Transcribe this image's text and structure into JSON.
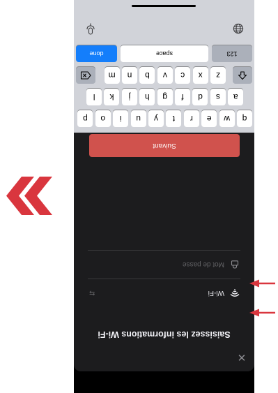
{
  "dialog": {
    "close_icon": "close-icon",
    "title": "Saisissez les informations Wi‑Fi",
    "network_field": {
      "value": "Wi‑Fi",
      "icon": "wifi-icon",
      "chevron": "⇆"
    },
    "password_field": {
      "placeholder": "Mot de passe",
      "icon": "lock-icon"
    },
    "next_label": "Suivant",
    "next_color": "#d0524d"
  },
  "keyboard": {
    "row1": [
      "q",
      "w",
      "e",
      "r",
      "t",
      "y",
      "u",
      "i",
      "o",
      "p"
    ],
    "row2": [
      "a",
      "s",
      "d",
      "f",
      "g",
      "h",
      "j",
      "k",
      "l"
    ],
    "row3": [
      "z",
      "x",
      "c",
      "v",
      "b",
      "n",
      "m"
    ],
    "numbers_label": "123",
    "space_label": "space",
    "done_label": "done",
    "done_color": "#147efb",
    "left_icon": "globe-icon",
    "right_icon": "microphone-icon"
  },
  "annotations": {
    "arrow_color": "#d9363e",
    "chevrons_icon": "double-chevron-icon"
  }
}
